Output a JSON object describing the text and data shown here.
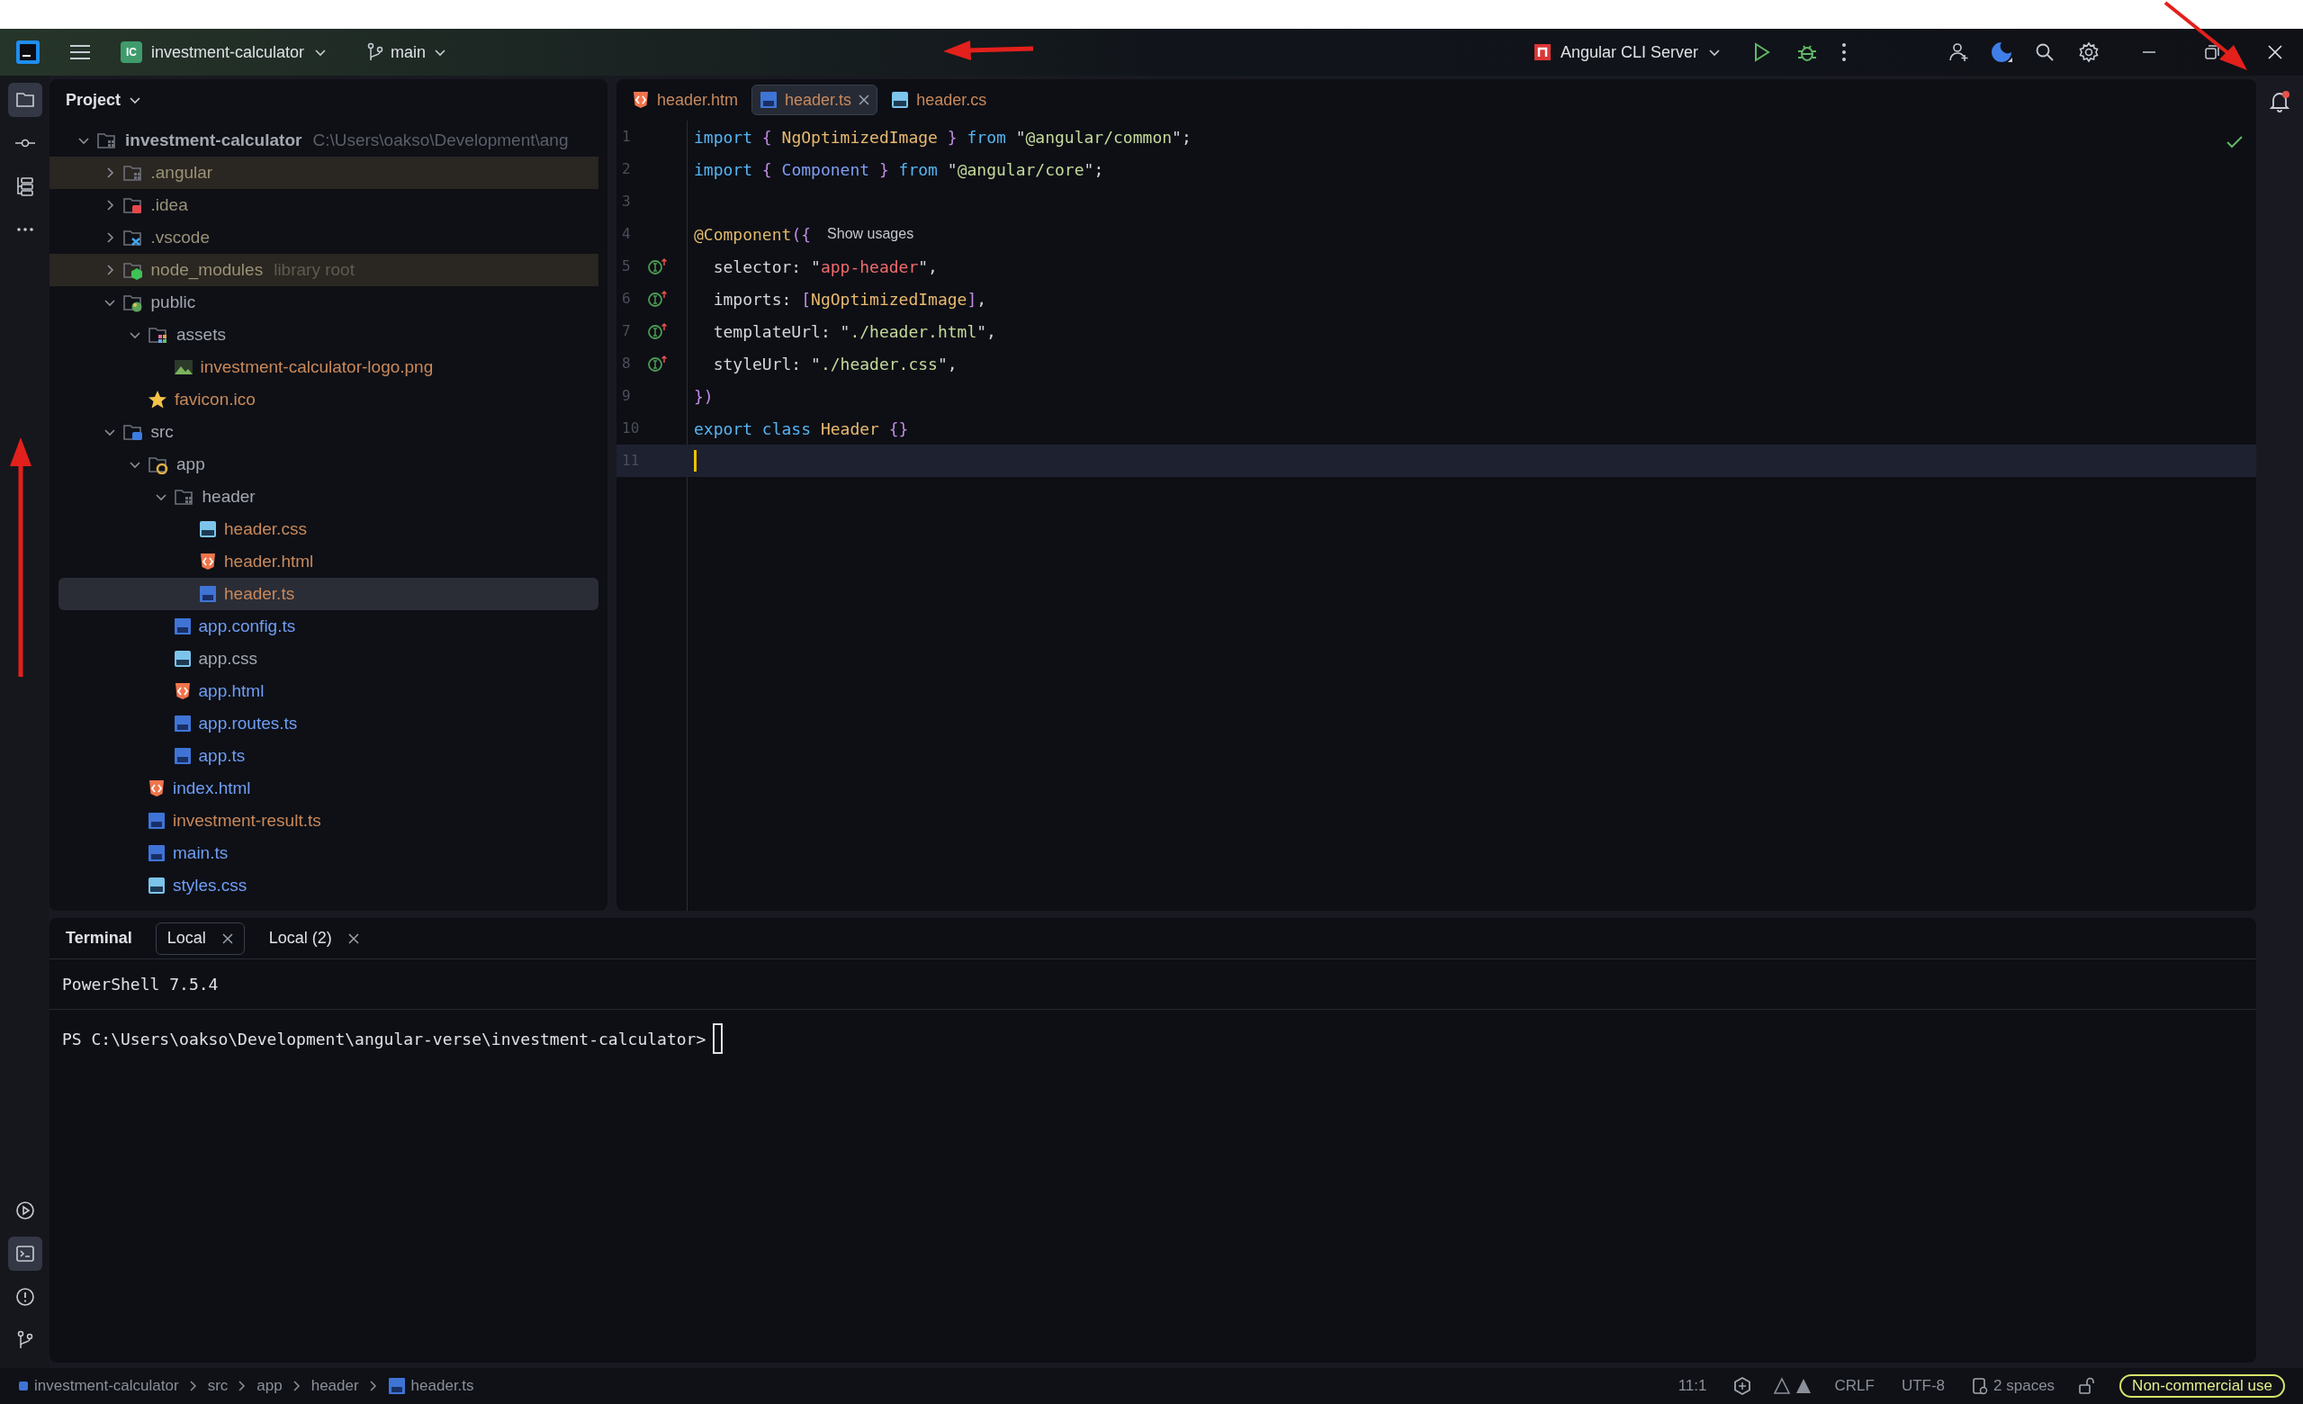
{
  "title_bar": {
    "project_badge": "IC",
    "project": "investment-calculator",
    "branch": "main",
    "run_config": "Angular CLI Server"
  },
  "tool_strip": {
    "top": [
      {
        "kind": "folder",
        "selected": true
      },
      {
        "kind": "commit",
        "selected": false
      },
      {
        "kind": "structure",
        "selected": false
      },
      {
        "kind": "more",
        "selected": false
      }
    ],
    "bottom": [
      {
        "kind": "run",
        "selected": false
      },
      {
        "kind": "terminal",
        "selected": true
      },
      {
        "kind": "problems",
        "selected": false
      },
      {
        "kind": "git",
        "selected": false
      }
    ]
  },
  "project_panel": {
    "title": "Project",
    "tree": [
      {
        "name": "investment-calculator",
        "path": "C:\\Users\\oakso\\Development\\ang",
        "kind": "folder",
        "color": "#a3a7b0",
        "expanded": true,
        "excluded": false,
        "selected": false,
        "children": [
          {
            "name": ".angular",
            "kind": "folder",
            "color": "#9a9277",
            "expanded": false,
            "excluded": true,
            "selected": false
          },
          {
            "name": ".idea",
            "kind": "idea",
            "color": "#9a9277",
            "expanded": false,
            "excluded": false,
            "selected": false
          },
          {
            "name": ".vscode",
            "kind": "vscode",
            "color": "#9a9277",
            "expanded": false,
            "excluded": false,
            "selected": false
          },
          {
            "name": "node_modules",
            "suffix": "library root",
            "kind": "node",
            "color": "#9a9277",
            "expanded": false,
            "excluded": true,
            "selected": false
          },
          {
            "name": "public",
            "kind": "public",
            "color": "#a3a7b0",
            "expanded": true,
            "excluded": false,
            "selected": false,
            "children": [
              {
                "name": "assets",
                "kind": "assets",
                "color": "#a3a7b0",
                "expanded": true,
                "excluded": false,
                "selected": false,
                "children": [
                  {
                    "name": "investment-calculator-logo.png",
                    "kind": "image",
                    "color": "#c9895a",
                    "excluded": false,
                    "selected": false
                  }
                ]
              },
              {
                "name": "favicon.ico",
                "kind": "star",
                "color": "#c9895a",
                "excluded": false,
                "selected": false
              }
            ]
          },
          {
            "name": "src",
            "kind": "src",
            "color": "#a3a7b0",
            "expanded": true,
            "excluded": false,
            "selected": false,
            "children": [
              {
                "name": "app",
                "kind": "app",
                "color": "#a3a7b0",
                "expanded": true,
                "excluded": false,
                "selected": false,
                "children": [
                  {
                    "name": "header",
                    "kind": "folder",
                    "color": "#a3a7b0",
                    "expanded": true,
                    "excluded": false,
                    "selected": false,
                    "children": [
                      {
                        "name": "header.css",
                        "kind": "css",
                        "color": "#c9895a",
                        "excluded": false,
                        "selected": false
                      },
                      {
                        "name": "header.html",
                        "kind": "html",
                        "color": "#c9895a",
                        "excluded": false,
                        "selected": false
                      },
                      {
                        "name": "header.ts",
                        "kind": "ts",
                        "color": "#c9895a",
                        "excluded": false,
                        "selected": true
                      }
                    ]
                  },
                  {
                    "name": "app.config.ts",
                    "kind": "ts",
                    "color": "#6f9ef5",
                    "excluded": false,
                    "selected": false
                  },
                  {
                    "name": "app.css",
                    "kind": "css",
                    "color": "#a3a7b0",
                    "excluded": false,
                    "selected": false
                  },
                  {
                    "name": "app.html",
                    "kind": "html",
                    "color": "#6f9ef5",
                    "excluded": false,
                    "selected": false
                  },
                  {
                    "name": "app.routes.ts",
                    "kind": "ts",
                    "color": "#6f9ef5",
                    "excluded": false,
                    "selected": false
                  },
                  {
                    "name": "app.ts",
                    "kind": "ts",
                    "color": "#6f9ef5",
                    "excluded": false,
                    "selected": false
                  }
                ]
              },
              {
                "name": "index.html",
                "kind": "html",
                "color": "#6f9ef5",
                "excluded": false,
                "selected": false
              },
              {
                "name": "investment-result.ts",
                "kind": "ts",
                "color": "#c9895a",
                "excluded": false,
                "selected": false
              },
              {
                "name": "main.ts",
                "kind": "ts",
                "color": "#6f9ef5",
                "excluded": false,
                "selected": false
              },
              {
                "name": "styles.css",
                "kind": "css",
                "color": "#6f9ef5",
                "excluded": false,
                "selected": false
              }
            ]
          }
        ]
      }
    ]
  },
  "editor": {
    "tabs": [
      {
        "label": "header.htm",
        "kind": "html",
        "selected": false
      },
      {
        "label": "header.ts",
        "kind": "ts",
        "selected": true
      },
      {
        "label": "header.cs",
        "kind": "css",
        "selected": false
      }
    ],
    "lines": [
      {
        "number": "1",
        "marker": false,
        "current": false,
        "tokens": [
          {
            "text": "import",
            "kind": "keyword"
          },
          {
            "text": " { ",
            "kind": "brace"
          },
          {
            "text": "NgOptimizedImage",
            "kind": "type"
          },
          {
            "text": " } ",
            "kind": "brace"
          },
          {
            "text": "from",
            "kind": "keyword"
          },
          {
            "text": " \"",
            "kind": "plain"
          },
          {
            "text": "@angular/common",
            "kind": "string"
          },
          {
            "text": "\";",
            "kind": "plain"
          }
        ]
      },
      {
        "number": "2",
        "marker": false,
        "current": false,
        "tokens": [
          {
            "text": "import",
            "kind": "keyword"
          },
          {
            "text": " { ",
            "kind": "brace"
          },
          {
            "text": "Component",
            "kind": "class"
          },
          {
            "text": " } ",
            "kind": "brace"
          },
          {
            "text": "from",
            "kind": "keyword"
          },
          {
            "text": " \"",
            "kind": "plain"
          },
          {
            "text": "@angular/core",
            "kind": "string"
          },
          {
            "text": "\";",
            "kind": "plain"
          }
        ]
      },
      {
        "number": "3",
        "marker": false,
        "current": false
      },
      {
        "number": "4",
        "marker": false,
        "current": false,
        "tokens": [
          {
            "text": "@Component",
            "kind": "decorator"
          },
          {
            "text": "({",
            "kind": "brace"
          }
        ],
        "hint": "Show usages"
      },
      {
        "number": "5",
        "marker": true,
        "current": false,
        "tokens": [
          {
            "text": "  selector: \"",
            "kind": "plain"
          },
          {
            "text": "app-header",
            "kind": "selector"
          },
          {
            "text": "\",",
            "kind": "plain"
          }
        ]
      },
      {
        "number": "6",
        "marker": true,
        "current": false,
        "tokens": [
          {
            "text": "  imports: ",
            "kind": "plain"
          },
          {
            "text": "[",
            "kind": "brace"
          },
          {
            "text": "NgOptimizedImage",
            "kind": "type"
          },
          {
            "text": "]",
            "kind": "brace"
          },
          {
            "text": ",",
            "kind": "plain"
          }
        ]
      },
      {
        "number": "7",
        "marker": true,
        "current": false,
        "tokens": [
          {
            "text": "  templateUrl: \"",
            "kind": "plain"
          },
          {
            "text": "./header.html",
            "kind": "string"
          },
          {
            "text": "\",",
            "kind": "plain"
          }
        ]
      },
      {
        "number": "8",
        "marker": true,
        "current": false,
        "tokens": [
          {
            "text": "  styleUrl: \"",
            "kind": "plain"
          },
          {
            "text": "./header.css",
            "kind": "string"
          },
          {
            "text": "\",",
            "kind": "plain"
          }
        ]
      },
      {
        "number": "9",
        "marker": false,
        "current": false,
        "tokens": [
          {
            "text": "})",
            "kind": "brace"
          }
        ]
      },
      {
        "number": "10",
        "marker": false,
        "current": false,
        "tokens": [
          {
            "text": "export class",
            "kind": "keyword"
          },
          {
            "text": " Header",
            "kind": "type"
          },
          {
            "text": " {}",
            "kind": "brace"
          }
        ]
      },
      {
        "number": "11",
        "marker": false,
        "current": true
      }
    ]
  },
  "terminal": {
    "title": "Terminal",
    "tabs": [
      {
        "label": "Local",
        "selected": true
      },
      {
        "label": "Local (2)",
        "selected": false
      }
    ],
    "banner": "PowerShell 7.5.4",
    "prompt": "PS C:\\Users\\oakso\\Development\\angular-verse\\investment-calculator>"
  },
  "status_bar": {
    "breadcrumbs": [
      {
        "label": "investment-calculator",
        "kind": "project"
      },
      {
        "label": "src",
        "kind": "folder"
      },
      {
        "label": "app",
        "kind": "folder"
      },
      {
        "label": "header",
        "kind": "folder"
      },
      {
        "label": "header.ts",
        "kind": "ts"
      }
    ],
    "position": "11:1",
    "line_separator": "CRLF",
    "encoding": "UTF-8",
    "indent": "2 spaces",
    "license": "Non-commercial use"
  }
}
